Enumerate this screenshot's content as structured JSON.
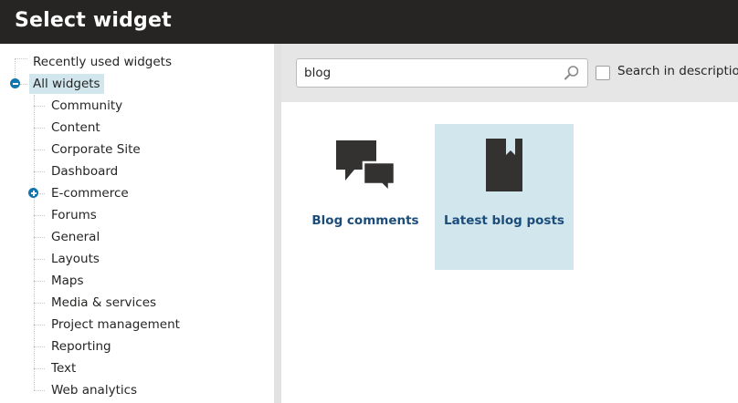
{
  "header": {
    "title": "Select widget"
  },
  "tree": {
    "recent": "Recently used widgets",
    "all": "All widgets",
    "categories": [
      "Community",
      "Content",
      "Corporate Site",
      "Dashboard",
      "E-commerce",
      "Forums",
      "General",
      "Layouts",
      "Maps",
      "Media & services",
      "Project management",
      "Reporting",
      "Text",
      "Web analytics"
    ]
  },
  "search": {
    "value": "blog",
    "search_in_description": "Search in description"
  },
  "widgets": [
    {
      "label": "Blog comments",
      "icon": "comments-icon"
    },
    {
      "label": "Latest blog posts",
      "icon": "bookmark-icon"
    }
  ],
  "colors": {
    "header_bg": "#262524",
    "selected_bg": "#d2e6ee",
    "link_blue": "#1b4c7a",
    "toggle_blue": "#1175ae"
  }
}
